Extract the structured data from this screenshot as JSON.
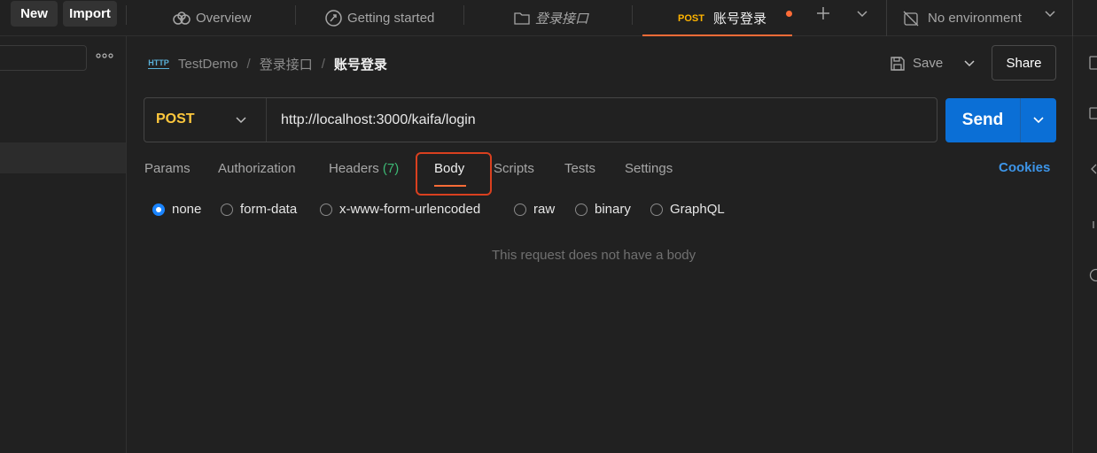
{
  "topbar": {
    "new_label": "New",
    "import_label": "Import",
    "tabs": [
      {
        "label": "Overview",
        "icon": "overview-icon"
      },
      {
        "label": "Getting started",
        "icon": "rocket-icon"
      },
      {
        "label": "登录接口",
        "icon": "folder-icon"
      },
      {
        "method": "POST",
        "label": "账号登录",
        "active": true,
        "unsaved": true
      }
    ],
    "add_tab_icon": "plus-icon",
    "tabs_menu_icon": "chevron-down-icon",
    "environment_label": "No environment",
    "environment_icon": "no-environment-icon"
  },
  "breadcrumb": {
    "icon": "HTTP",
    "items": [
      "TestDemo",
      "登录接口"
    ],
    "current": "账号登录",
    "separator": "/"
  },
  "actions": {
    "save_label": "Save",
    "share_label": "Share"
  },
  "request": {
    "method": "POST",
    "url": "http://localhost:3000/kaifa/login",
    "send_label": "Send"
  },
  "request_tabs": [
    {
      "label": "Params"
    },
    {
      "label": "Authorization"
    },
    {
      "label": "Headers",
      "count": "(7)"
    },
    {
      "label": "Body",
      "active": true
    },
    {
      "label": "Scripts"
    },
    {
      "label": "Tests"
    },
    {
      "label": "Settings"
    }
  ],
  "cookies_label": "Cookies",
  "body_types": [
    {
      "label": "none",
      "checked": true
    },
    {
      "label": "form-data"
    },
    {
      "label": "x-www-form-urlencoded"
    },
    {
      "label": "raw"
    },
    {
      "label": "binary"
    },
    {
      "label": "GraphQL"
    }
  ],
  "empty_body_message": "This request does not have a body",
  "colors": {
    "accent_orange": "#ff6c37",
    "send_blue": "#0b6fd6",
    "method_yellow": "#ffc83d",
    "cookies_blue": "#3d95e8",
    "headers_count_green": "#3db874",
    "highlight_red": "#d9401f"
  }
}
